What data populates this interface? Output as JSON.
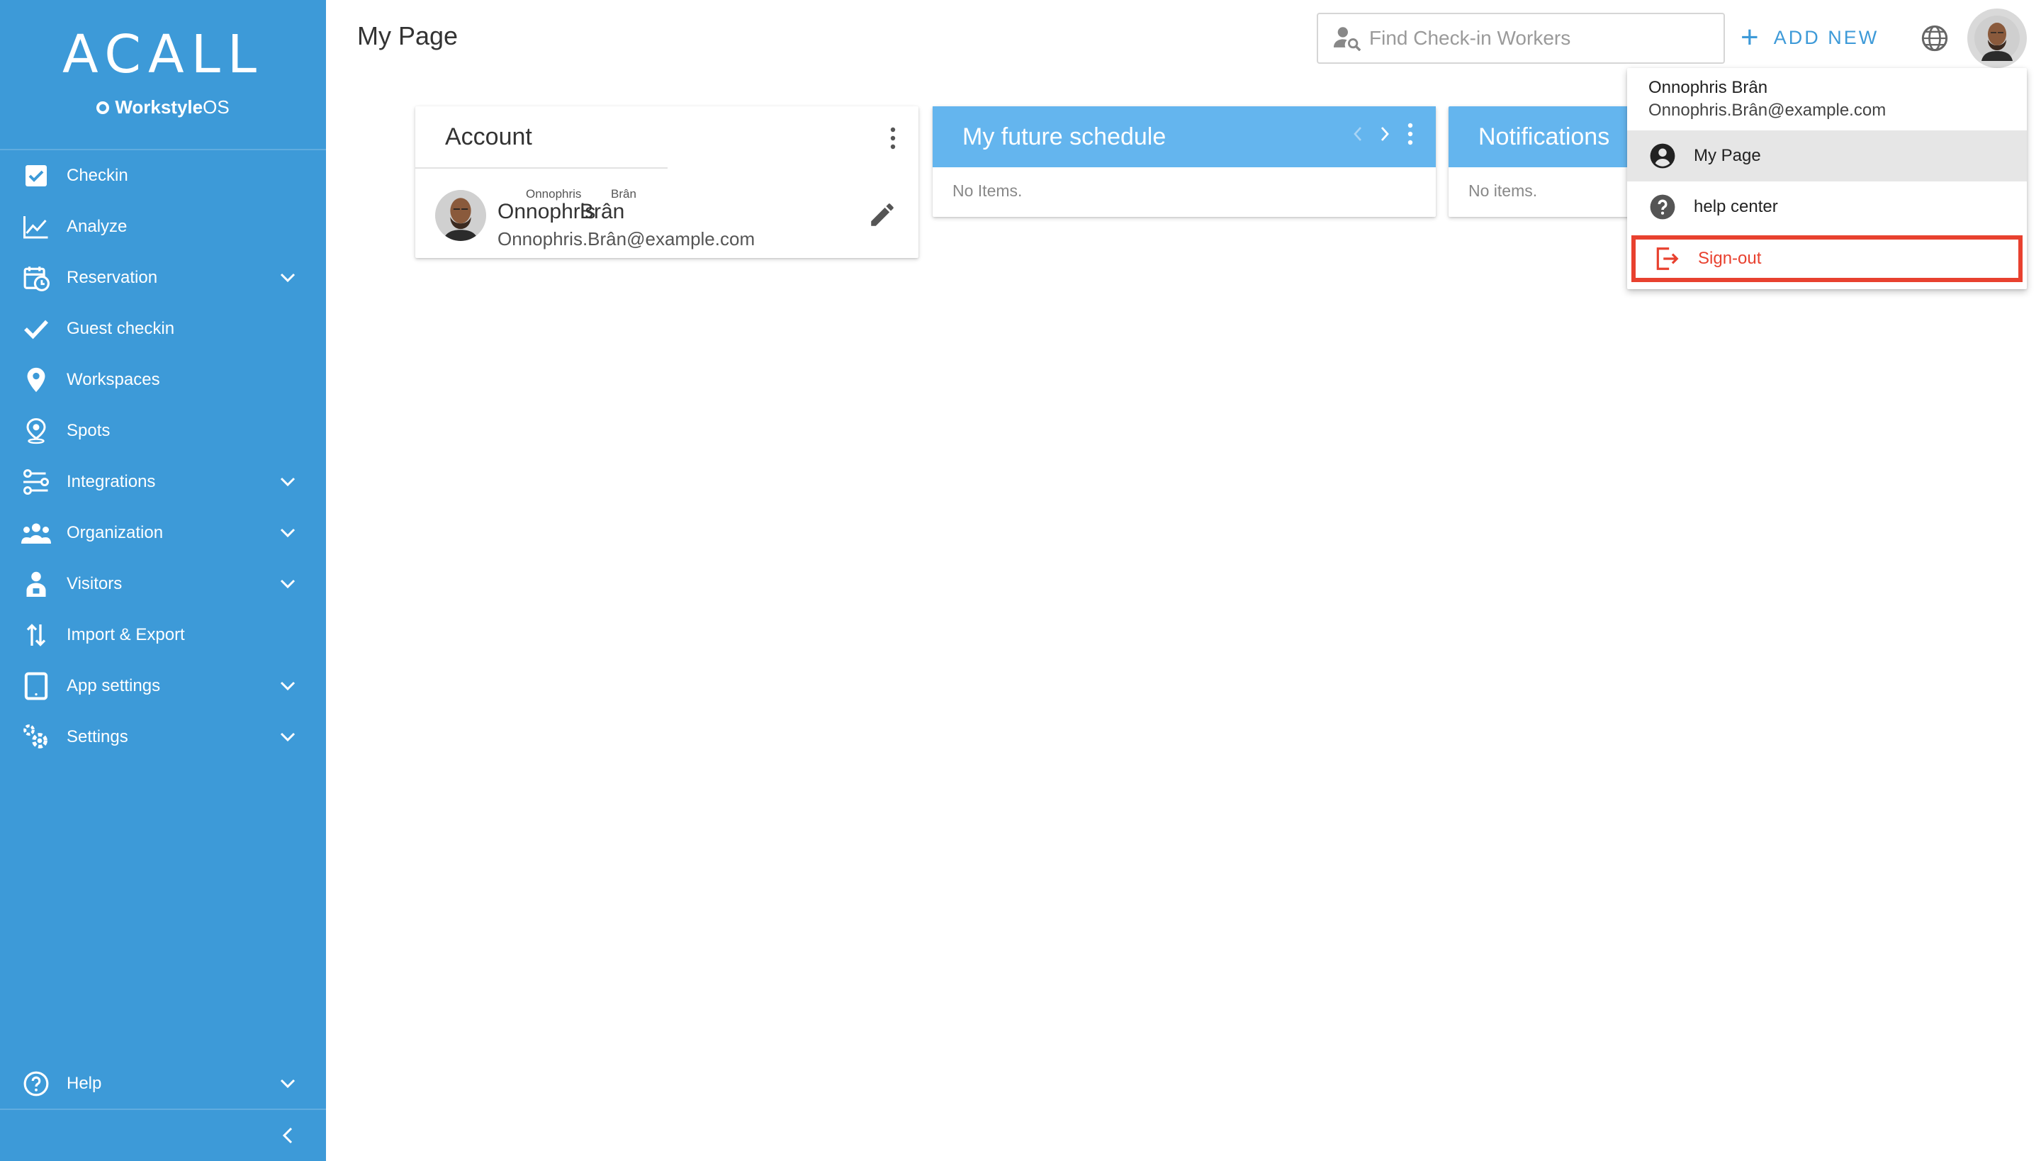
{
  "sidebar": {
    "logo": "ACALL",
    "tagline_bold": "Workstyle",
    "tagline_light": "OS",
    "items": [
      {
        "label": "Checkin"
      },
      {
        "label": "Analyze"
      },
      {
        "label": "Reservation"
      },
      {
        "label": "Guest checkin"
      },
      {
        "label": "Workspaces"
      },
      {
        "label": "Spots"
      },
      {
        "label": "Integrations"
      },
      {
        "label": "Organization"
      },
      {
        "label": "Visitors"
      },
      {
        "label": "Import & Export"
      },
      {
        "label": "App settings"
      },
      {
        "label": "Settings"
      }
    ],
    "help_label": "Help"
  },
  "header": {
    "title": "My Page",
    "search_placeholder": "Find Check-in Workers",
    "add_new_label": "ADD NEW"
  },
  "account_card": {
    "title": "Account",
    "first_name_ruby": "Onnophris",
    "last_name_ruby": "Brân",
    "first_name": "Onnophris",
    "last_name": "Brân",
    "email": "Onnophris.Brân@example.com"
  },
  "schedule_card": {
    "title": "My future schedule",
    "empty_text": "No Items."
  },
  "notifications_card": {
    "title": "Notifications",
    "empty_text": "No items."
  },
  "user_menu": {
    "name": "Onnophris Brân",
    "email": "Onnophris.Brân@example.com",
    "my_page_label": "My Page",
    "help_center_label": "help center",
    "sign_out_label": "Sign-out"
  },
  "colors": {
    "sidebar": "#3d9ad8",
    "card_header": "#64b5ee",
    "accent": "#3d9ad8",
    "highlight": "#e8412f"
  }
}
